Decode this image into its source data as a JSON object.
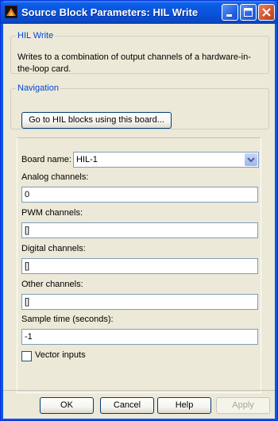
{
  "window": {
    "title": "Source Block Parameters: HIL Write"
  },
  "description": {
    "legend": "HIL Write",
    "text": "Writes to a combination of output channels of a hardware-in-the-loop card."
  },
  "navigation": {
    "legend": "Navigation",
    "goto_label": "Go to HIL blocks using this board..."
  },
  "params": {
    "board_name_label": "Board name:",
    "board_name_value": "HIL-1",
    "analog_label": "Analog channels:",
    "analog_value": "0",
    "pwm_label": "PWM channels:",
    "pwm_value": "[]",
    "digital_label": "Digital channels:",
    "digital_value": "[]",
    "other_label": "Other channels:",
    "other_value": "[]",
    "sample_label": "Sample time (seconds):",
    "sample_value": "-1",
    "vector_label": "Vector inputs",
    "vector_checked": false
  },
  "buttons": {
    "ok": "OK",
    "cancel": "Cancel",
    "help": "Help",
    "apply": "Apply"
  },
  "colors": {
    "titlebar": "#0a54dc",
    "legend": "#0046d5",
    "dialog_bg": "#ece9d8"
  }
}
